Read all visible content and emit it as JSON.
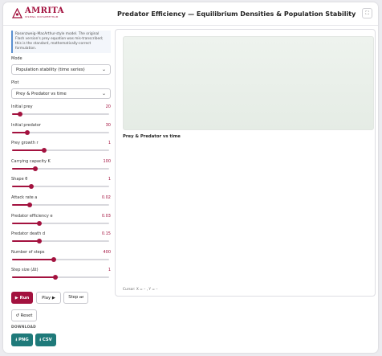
{
  "header": {
    "logo_text": "AMRITA",
    "logo_sub": "VISHWA VIDYAPEETHAM",
    "title": "Predator Efficiency — Equilibrium Densities & Population Stability",
    "expand_icon": "expand-icon"
  },
  "note": "Rosenzweig–MacArthur-style model. The original Flash version's prey equation was mis-transcribed; this is the standard, mathematically-correct formulation.",
  "mode": {
    "label": "Mode",
    "value": "Population stability (time series)"
  },
  "plot_select": {
    "label": "Plot",
    "value": "Prey & Predator vs time"
  },
  "sliders": [
    {
      "label": "Initial prey",
      "value": "20",
      "fraction": 0.08
    },
    {
      "label": "Initial predator",
      "value": "30",
      "fraction": 0.16
    },
    {
      "label": "Prey growth r",
      "value": "1",
      "fraction": 0.33
    },
    {
      "label": "Carrying capacity K",
      "value": "100",
      "fraction": 0.24
    },
    {
      "label": "Shape θ",
      "value": "1",
      "fraction": 0.2
    },
    {
      "label": "Attack rate a",
      "value": "0.02",
      "fraction": 0.18
    },
    {
      "label": "Predator efficiency e",
      "value": "0.03",
      "fraction": 0.28
    },
    {
      "label": "Predator death d",
      "value": "0.15",
      "fraction": 0.28
    },
    {
      "label": "Number of steps",
      "value": "400",
      "fraction": 0.43
    },
    {
      "label": "Step size (Δt)",
      "value": "1",
      "fraction": 0.45
    }
  ],
  "buttons": {
    "run": "▶ Run",
    "play": "Play ▶",
    "step": "Step ⏭",
    "reset": "↺ Reset",
    "download_heading": "DOWNLOAD",
    "png": "⭳ PNG",
    "csv": "⭳ CSV"
  },
  "plot": {
    "title": "Prey & Predator vs time",
    "cursor": "Cursor: X = – , Y = –"
  },
  "colors": {
    "accent": "#a3123f",
    "download": "#1f7a7a",
    "note_border": "#5a8fd0"
  }
}
